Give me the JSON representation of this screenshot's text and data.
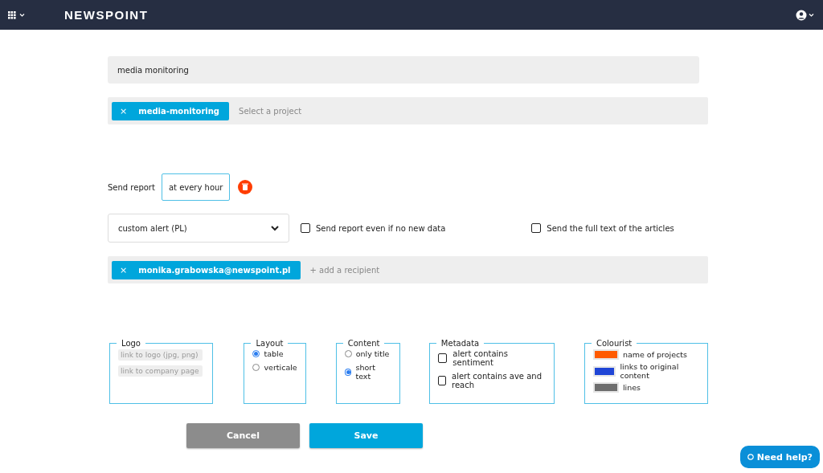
{
  "header": {
    "logo": "NEWSPOINT"
  },
  "alert_name": {
    "value": "media monitoring"
  },
  "projects": {
    "tags": [
      "media-monitoring"
    ],
    "placeholder": "Select a project",
    "remove_glyph": "×"
  },
  "schedule": {
    "label": "Send report",
    "value": "at every hour"
  },
  "template": {
    "value": "custom alert (PL)"
  },
  "options": [
    {
      "label": "Send report even if no new data",
      "checked": false
    },
    {
      "label": "Send the full text of the articles",
      "checked": false
    }
  ],
  "recipients": {
    "tags": [
      "monika.grabowska@newspoint.pl"
    ],
    "placeholder": "+ add a recipient",
    "remove_glyph": "×"
  },
  "panels": [
    {
      "kind": "fields",
      "title": "Logo",
      "fields": [
        {
          "placeholder": "link to logo (jpg, png)"
        },
        {
          "placeholder": "link to company page"
        }
      ]
    },
    {
      "kind": "radios",
      "title": "Layout",
      "items": [
        {
          "label": "table",
          "selected": true
        },
        {
          "label": "verticale",
          "selected": false
        }
      ]
    },
    {
      "kind": "radios",
      "title": "Content",
      "items": [
        {
          "label": "only title",
          "selected": false
        },
        {
          "label": "short text",
          "selected": true
        }
      ]
    },
    {
      "kind": "checks",
      "title": "Metadata",
      "items": [
        {
          "label": "alert contains sentiment",
          "checked": false
        },
        {
          "label": "alert contains ave and reach",
          "checked": false
        }
      ]
    },
    {
      "kind": "colours",
      "title": "Colourist",
      "items": [
        {
          "label": "name of projects",
          "color": "#ff5a00"
        },
        {
          "label": "links to original content",
          "color": "#1f45d6"
        },
        {
          "label": "lines",
          "color": "#6e6e6e"
        }
      ]
    }
  ],
  "buttons": [
    {
      "kind": "cancel",
      "label": "Cancel"
    },
    {
      "kind": "save",
      "label": "Save"
    }
  ],
  "help": {
    "label": "Need help?"
  }
}
